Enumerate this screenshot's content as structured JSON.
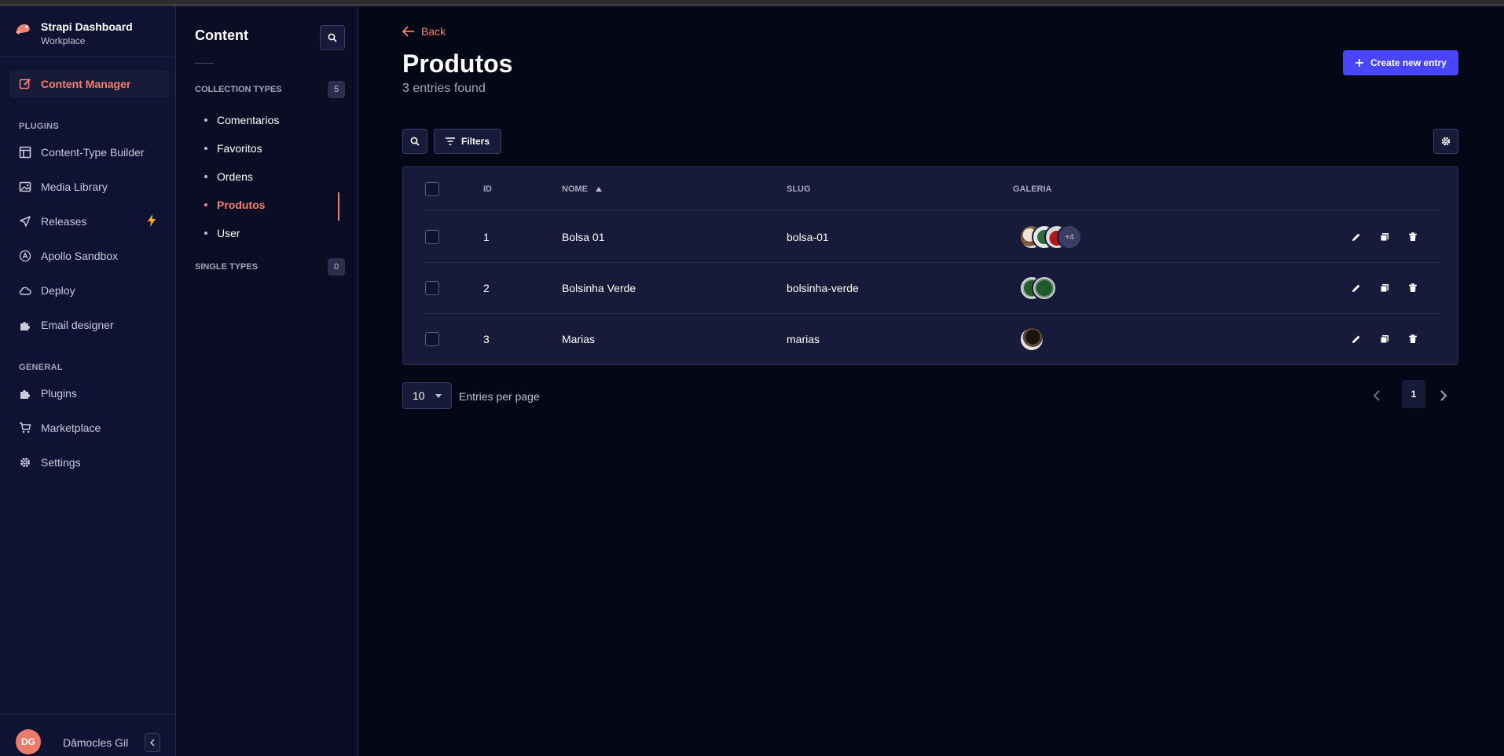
{
  "brand": {
    "title": "Strapi Dashboard",
    "subtitle": "Workplace",
    "logo_icon": "strapi-logo-icon"
  },
  "mainnav": {
    "active": {
      "label": "Content Manager",
      "icon": "pencil-square-icon"
    },
    "plugins_heading": "PLUGINS",
    "plugins": [
      {
        "label": "Content-Type Builder",
        "icon": "layout-icon"
      },
      {
        "label": "Media Library",
        "icon": "image-icon"
      },
      {
        "label": "Releases",
        "icon": "paper-plane-icon",
        "badge_icon": "lightning-icon"
      },
      {
        "label": "Apollo Sandbox",
        "icon": "apollo-icon"
      },
      {
        "label": "Deploy",
        "icon": "cloud-icon"
      },
      {
        "label": "Email designer",
        "icon": "puzzle-icon"
      }
    ],
    "general_heading": "GENERAL",
    "general": [
      {
        "label": "Plugins",
        "icon": "puzzle-icon"
      },
      {
        "label": "Marketplace",
        "icon": "cart-icon"
      },
      {
        "label": "Settings",
        "icon": "gear-icon"
      }
    ],
    "user": {
      "initials": "DG",
      "name": "Dâmocles Gil"
    }
  },
  "subnav": {
    "heading": "Content",
    "collection_heading": "COLLECTION TYPES",
    "collection_count": "5",
    "collection_items": [
      {
        "label": "Comentarios",
        "active": false
      },
      {
        "label": "Favoritos",
        "active": false
      },
      {
        "label": "Ordens",
        "active": false
      },
      {
        "label": "Produtos",
        "active": true
      },
      {
        "label": "User",
        "active": false
      }
    ],
    "single_heading": "SINGLE TYPES",
    "single_count": "0"
  },
  "main": {
    "back_label": "Back",
    "title": "Produtos",
    "entries_found": "3 entries found",
    "create_label": "Create new entry",
    "filters_label": "Filters",
    "columns": {
      "id": "ID",
      "nome": "NOME",
      "slug": "SLUG",
      "galeria": "GALERIA"
    },
    "sort_icon": "sort-asc-icon",
    "rows": [
      {
        "id": "1",
        "nome": "Bolsa 01",
        "slug": "bolsa-01",
        "gallery_more": "+4"
      },
      {
        "id": "2",
        "nome": "Bolsinha Verde",
        "slug": "bolsinha-verde",
        "gallery_more": ""
      },
      {
        "id": "3",
        "nome": "Marias",
        "slug": "marias",
        "gallery_more": ""
      }
    ],
    "per_page_value": "10",
    "per_page_label": "Entries per page",
    "current_page": "1"
  },
  "colors": {
    "accent": "#f6806e",
    "primary": "#4945ff",
    "background": "#040715",
    "nav_bg": "#0f1232"
  }
}
